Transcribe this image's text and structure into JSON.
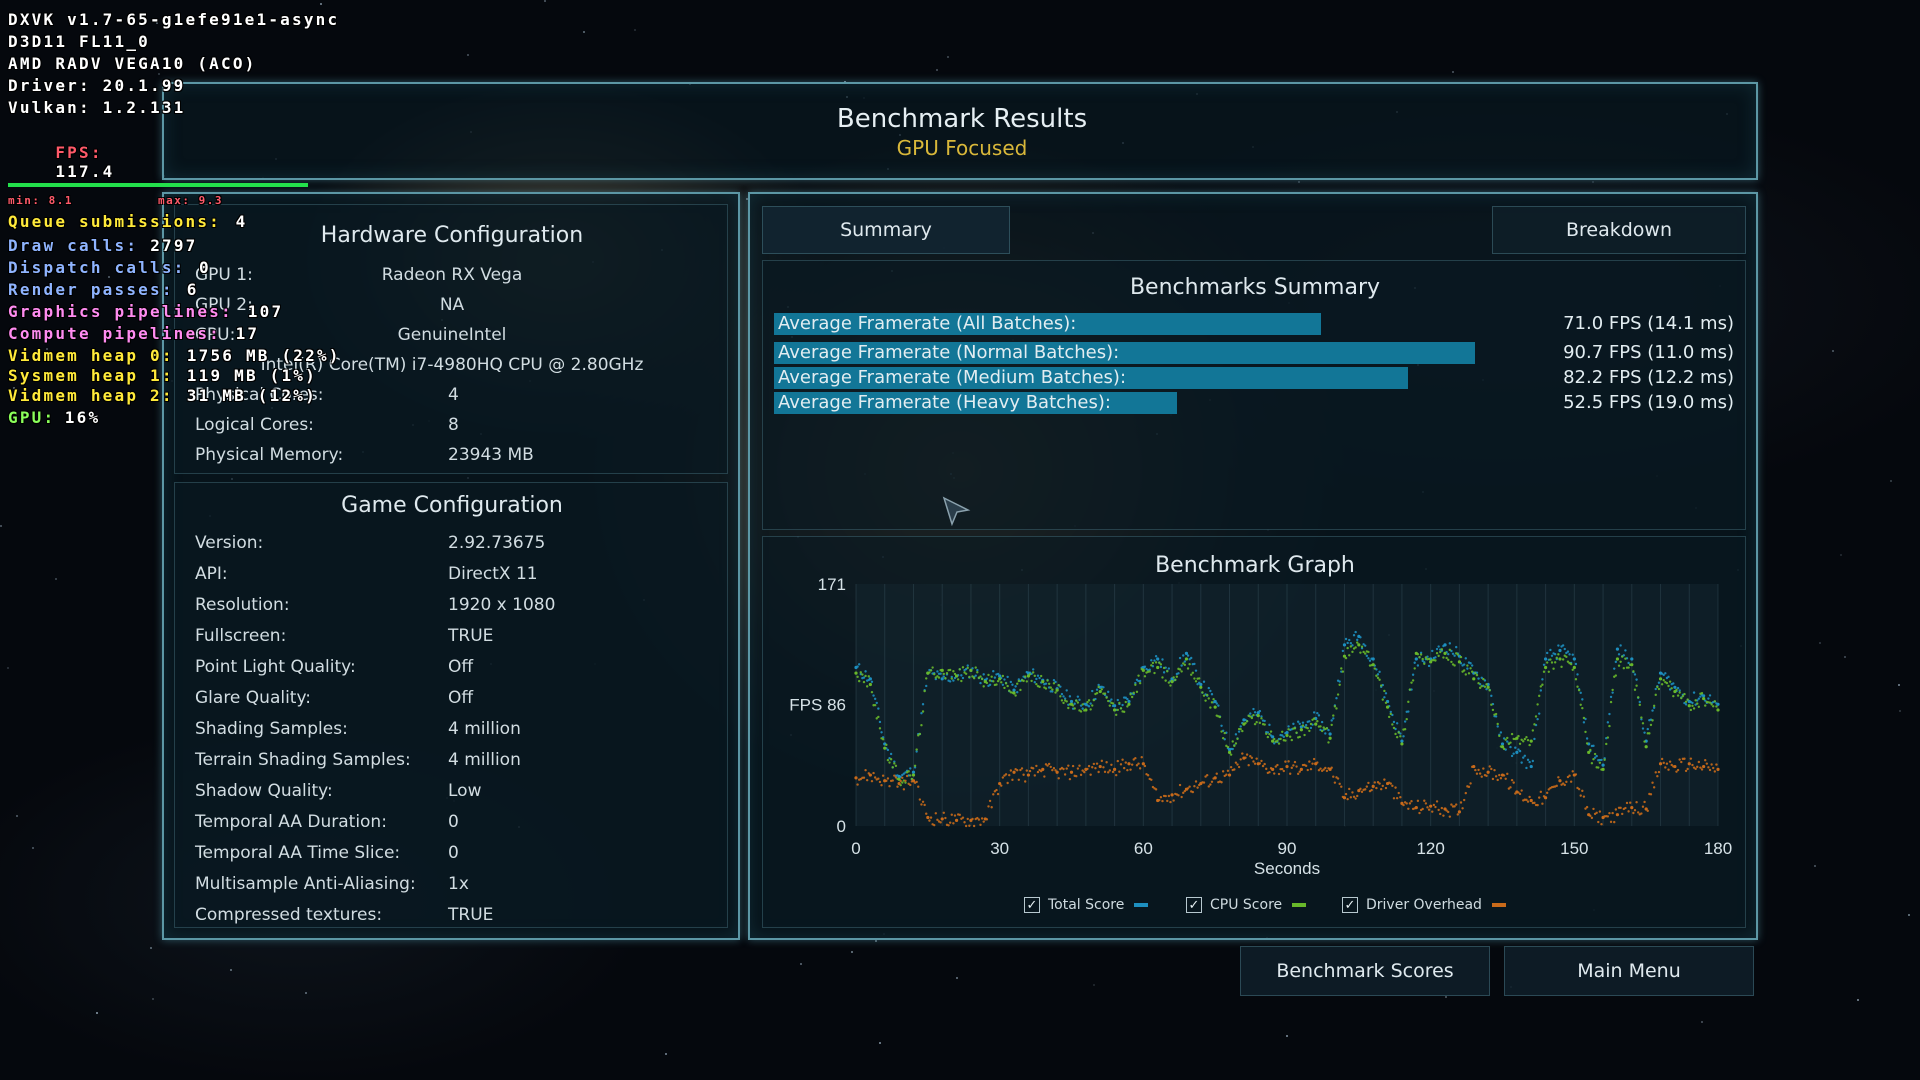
{
  "hud": {
    "lines": [
      {
        "text": "DXVK v1.7-65-g1efe91e1-async",
        "color": "white"
      },
      {
        "text": "D3D11 FL11_0",
        "color": "white"
      },
      {
        "text": "AMD RADV VEGA10 (ACO)",
        "color": "white"
      },
      {
        "text": "Driver: 20.1.99",
        "color": "white"
      },
      {
        "text": "Vulkan: 1.2.131",
        "color": "white"
      }
    ],
    "fps_label": "FPS:",
    "fps_value": "117.4",
    "min_label": "min: 8.1",
    "max_label": "max: 9.3",
    "stats": [
      {
        "label": "Queue submissions:",
        "value": "4",
        "color": "yellow"
      },
      {
        "label": "Draw calls:",
        "value": "2797",
        "color": "blue"
      },
      {
        "label": "Dispatch calls:",
        "value": "0",
        "color": "blue"
      },
      {
        "label": "Render passes:",
        "value": "6",
        "color": "blue"
      },
      {
        "label": "Graphics pipelines:",
        "value": "107",
        "color": "pink"
      },
      {
        "label": "Compute pipelines:",
        "value": "17",
        "color": "pink"
      },
      {
        "label": "Vidmem heap 0:",
        "value": "1756 MB (22%)",
        "color": "yellow"
      },
      {
        "label": "Sysmem heap 1:",
        "value": "119 MB (1%)",
        "color": "yellow"
      },
      {
        "label": "Vidmem heap 2:",
        "value": "31 MB (12%)",
        "color": "yellow"
      },
      {
        "label": "GPU:",
        "value": "16%",
        "color": "green"
      }
    ]
  },
  "header": {
    "title": "Benchmark Results",
    "subtitle": "GPU Focused"
  },
  "hardware": {
    "title": "Hardware Configuration",
    "rows": [
      {
        "label": "GPU 1:",
        "value": "Radeon RX Vega"
      },
      {
        "label": "GPU 2:",
        "value": "NA"
      },
      {
        "label": "CPU:",
        "value": "GenuineIntel"
      },
      {
        "label": "",
        "value": "Intel(R) Core(TM) i7-4980HQ CPU @ 2.80GHz"
      },
      {
        "label": "Physical Cores:",
        "value": "4"
      },
      {
        "label": "Logical Cores:",
        "value": "8"
      },
      {
        "label": "Physical Memory:",
        "value": "23943  MB"
      }
    ]
  },
  "game": {
    "title": "Game Configuration",
    "rows": [
      {
        "label": "Version:",
        "value": "2.92.73675"
      },
      {
        "label": "API:",
        "value": "DirectX 11"
      },
      {
        "label": "Resolution:",
        "value": "1920 x 1080"
      },
      {
        "label": "Fullscreen:",
        "value": "TRUE"
      },
      {
        "label": "Point Light Quality:",
        "value": "Off"
      },
      {
        "label": "Glare Quality:",
        "value": "Off"
      },
      {
        "label": "Shading Samples:",
        "value": "4 million"
      },
      {
        "label": "Terrain Shading Samples:",
        "value": "4 million"
      },
      {
        "label": "Shadow Quality:",
        "value": "Low"
      },
      {
        "label": "Temporal AA Duration:",
        "value": "0"
      },
      {
        "label": "Temporal AA Time Slice:",
        "value": "0"
      },
      {
        "label": "Multisample Anti-Aliasing:",
        "value": "1x"
      },
      {
        "label": "Compressed textures:",
        "value": "TRUE"
      }
    ]
  },
  "tabs": {
    "summary": "Summary",
    "breakdown": "Breakdown"
  },
  "summary": {
    "title": "Benchmarks Summary",
    "bars": [
      {
        "label": "Average Framerate (All Batches):",
        "value": "71.0 FPS (14.1 ms)",
        "fraction": 0.57
      },
      {
        "label": "Average Framerate (Normal Batches):",
        "value": "90.7 FPS (11.0 ms)",
        "fraction": 0.73
      },
      {
        "label": "Average Framerate (Medium Batches):",
        "value": "82.2 FPS (12.2 ms)",
        "fraction": 0.66
      },
      {
        "label": "Average Framerate (Heavy Batches):",
        "value": "52.5 FPS (19.0 ms)",
        "fraction": 0.42
      }
    ]
  },
  "chart_data": {
    "type": "scatter",
    "title": "Benchmark Graph",
    "xlabel": "Seconds",
    "ylabel": "FPS",
    "xlim": [
      0,
      180
    ],
    "ylim": [
      0,
      171
    ],
    "x_ticks": [
      0,
      30,
      60,
      90,
      120,
      150,
      180
    ],
    "y_ticks": [
      {
        "value": 0,
        "label": "0"
      },
      {
        "value": 86,
        "label": "FPS 86"
      },
      {
        "value": 171,
        "label": "171"
      }
    ],
    "series": [
      {
        "name": "Total Score",
        "color": "#1d8fc0",
        "x": [
          0,
          3,
          6,
          9,
          12,
          15,
          18,
          21,
          24,
          27,
          30,
          33,
          36,
          39,
          42,
          45,
          48,
          51,
          54,
          57,
          60,
          63,
          66,
          69,
          72,
          75,
          78,
          81,
          84,
          87,
          90,
          93,
          96,
          99,
          102,
          105,
          108,
          111,
          114,
          117,
          120,
          123,
          126,
          129,
          132,
          135,
          138,
          141,
          144,
          147,
          150,
          153,
          156,
          159,
          162,
          165,
          168,
          171,
          174,
          177,
          180
        ],
        "y": [
          112,
          104,
          58,
          35,
          38,
          108,
          104,
          106,
          110,
          103,
          106,
          96,
          108,
          103,
          97,
          88,
          86,
          98,
          85,
          88,
          112,
          118,
          104,
          122,
          100,
          88,
          54,
          75,
          80,
          63,
          66,
          70,
          76,
          65,
          128,
          134,
          118,
          88,
          60,
          118,
          118,
          128,
          120,
          108,
          100,
          58,
          52,
          42,
          118,
          124,
          118,
          58,
          43,
          125,
          118,
          60,
          108,
          98,
          88,
          92,
          86
        ]
      },
      {
        "name": "CPU Score",
        "color": "#68b82a",
        "x": [
          0,
          3,
          6,
          9,
          12,
          15,
          18,
          21,
          24,
          27,
          30,
          33,
          36,
          39,
          42,
          45,
          48,
          51,
          54,
          57,
          60,
          63,
          66,
          69,
          72,
          75,
          78,
          81,
          84,
          87,
          90,
          93,
          96,
          99,
          102,
          105,
          108,
          111,
          114,
          117,
          120,
          123,
          126,
          129,
          132,
          135,
          138,
          141,
          144,
          147,
          150,
          153,
          156,
          159,
          162,
          165,
          168,
          171,
          174,
          177,
          180
        ],
        "y": [
          108,
          100,
          55,
          33,
          36,
          108,
          110,
          106,
          110,
          102,
          104,
          94,
          106,
          102,
          96,
          86,
          82,
          95,
          82,
          86,
          110,
          112,
          102,
          118,
          98,
          84,
          52,
          72,
          78,
          60,
          64,
          68,
          72,
          62,
          120,
          128,
          114,
          84,
          58,
          122,
          116,
          122,
          116,
          104,
          98,
          56,
          62,
          60,
          112,
          118,
          112,
          52,
          40,
          118,
          114,
          56,
          104,
          95,
          85,
          90,
          82
        ]
      },
      {
        "name": "Driver Overhead",
        "color": "#c96a1a",
        "x": [
          0,
          3,
          6,
          9,
          12,
          15,
          18,
          21,
          24,
          27,
          30,
          33,
          36,
          39,
          42,
          45,
          48,
          51,
          54,
          57,
          60,
          63,
          66,
          69,
          72,
          75,
          78,
          81,
          84,
          87,
          90,
          93,
          96,
          99,
          102,
          105,
          108,
          111,
          114,
          117,
          120,
          123,
          126,
          129,
          132,
          135,
          138,
          141,
          144,
          147,
          150,
          153,
          156,
          159,
          162,
          165,
          168,
          171,
          174,
          177,
          180
        ],
        "y": [
          34,
          36,
          32,
          30,
          32,
          6,
          5,
          4,
          4,
          5,
          30,
          38,
          36,
          40,
          38,
          38,
          40,
          42,
          40,
          44,
          44,
          18,
          22,
          26,
          30,
          34,
          36,
          48,
          44,
          40,
          42,
          40,
          44,
          40,
          20,
          25,
          28,
          30,
          16,
          13,
          14,
          12,
          10,
          42,
          38,
          36,
          24,
          18,
          20,
          32,
          36,
          8,
          6,
          8,
          13,
          12,
          44,
          42,
          44,
          42,
          40
        ]
      }
    ]
  },
  "legend": [
    {
      "label": "Total Score",
      "color": "#1d8fc0"
    },
    {
      "label": "CPU Score",
      "color": "#68b82a"
    },
    {
      "label": "Driver Overhead",
      "color": "#c96a1a"
    }
  ],
  "buttons": {
    "benchmark_scores": "Benchmark Scores",
    "main_menu": "Main Menu"
  }
}
